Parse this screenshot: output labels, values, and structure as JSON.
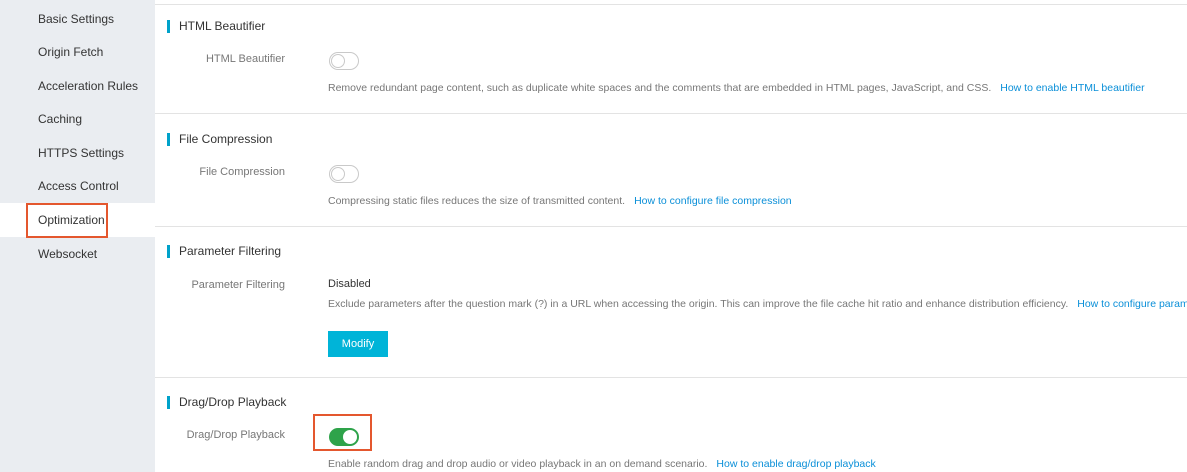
{
  "sidebar": {
    "items": [
      {
        "label": "Basic Settings"
      },
      {
        "label": "Origin Fetch"
      },
      {
        "label": "Acceleration Rules"
      },
      {
        "label": "Caching"
      },
      {
        "label": "HTTPS Settings"
      },
      {
        "label": "Access Control"
      },
      {
        "label": "Optimization",
        "active": true
      },
      {
        "label": "Websocket"
      }
    ]
  },
  "sections": {
    "html_beautifier": {
      "title": "HTML Beautifier",
      "label": "HTML Beautifier",
      "enabled": false,
      "description": "Remove redundant page content, such as duplicate white spaces and the comments that are embedded in HTML pages, JavaScript, and CSS.",
      "link": "How to enable HTML beautifier"
    },
    "file_compression": {
      "title": "File Compression",
      "label": "File Compression",
      "enabled": false,
      "description": "Compressing static files reduces the size of transmitted content.",
      "link": "How to configure file compression"
    },
    "parameter_filtering": {
      "title": "Parameter Filtering",
      "label": "Parameter Filtering",
      "status": "Disabled",
      "description": "Exclude parameters after the question mark (?) in a URL when accessing the origin. This can improve the file cache hit ratio and enhance distribution efficiency.",
      "link": "How to configure parameter filtering",
      "button": "Modify"
    },
    "drag_drop": {
      "title": "Drag/Drop Playback",
      "label": "Drag/Drop Playback",
      "enabled": true,
      "description": "Enable random drag and drop audio or video playback in an on demand scenario.",
      "link": "How to enable drag/drop playback"
    }
  },
  "colors": {
    "accent": "#00a2ca",
    "toggle_on": "#2ea34a",
    "highlight": "#e4572e",
    "link": "#0a8fd8"
  }
}
